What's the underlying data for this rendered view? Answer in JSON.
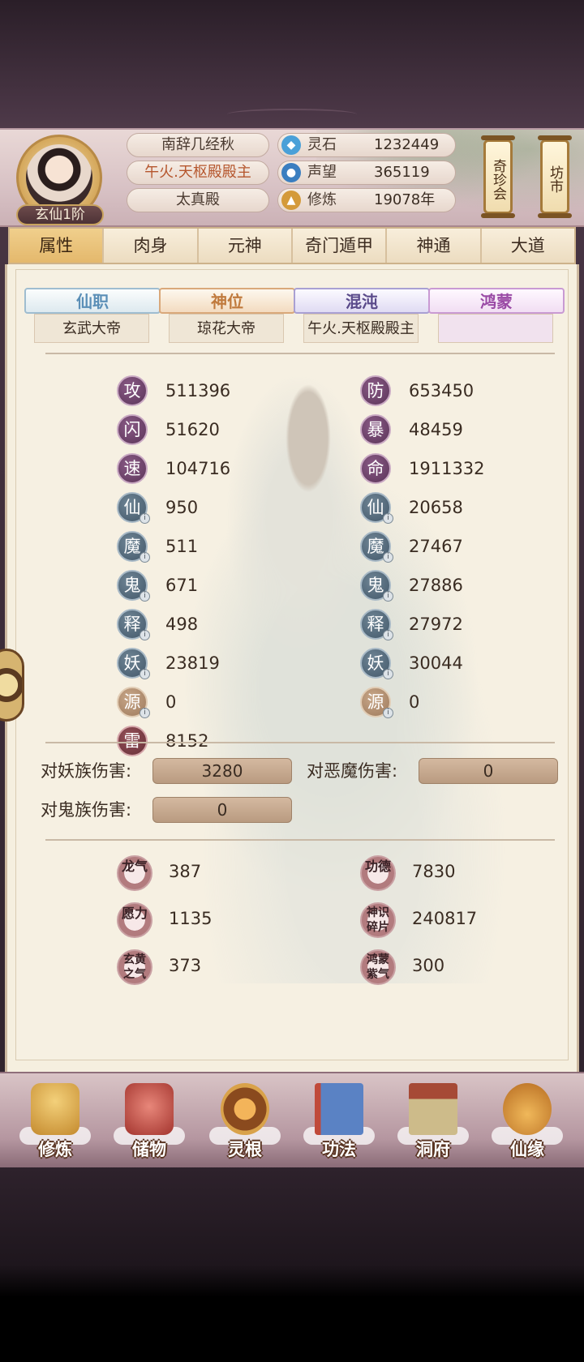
{
  "header": {
    "realm": "玄仙1阶",
    "titles": [
      "南辞几经秋",
      "午火.天枢殿殿主",
      "太真殿"
    ],
    "resources": [
      {
        "icon": "spirit-stone-icon",
        "label": "灵石",
        "value": "1232449"
      },
      {
        "icon": "prestige-icon",
        "label": "声望",
        "value": "365119"
      },
      {
        "icon": "cultivation-icon",
        "label": "修炼",
        "value": "19078年"
      }
    ],
    "side_buttons": [
      "奇珍会",
      "坊市"
    ]
  },
  "tabs": [
    {
      "label": "属性",
      "active": true
    },
    {
      "label": "肉身"
    },
    {
      "label": "元神"
    },
    {
      "label": "奇门遁甲"
    },
    {
      "label": "神通"
    },
    {
      "label": "大道"
    }
  ],
  "positions": [
    {
      "title": "仙职",
      "value": "玄武大帝"
    },
    {
      "title": "神位",
      "value": "琼花大帝"
    },
    {
      "title": "混沌",
      "value": "午火.天枢殿殿主"
    },
    {
      "title": "鸿蒙",
      "value": ""
    }
  ],
  "stats_left": [
    {
      "glyph": "攻",
      "value": "511396",
      "style": "purple"
    },
    {
      "glyph": "闪",
      "value": "51620",
      "style": "purple"
    },
    {
      "glyph": "速",
      "value": "104716",
      "style": "purple"
    },
    {
      "glyph": "仙",
      "value": "950",
      "style": "blue"
    },
    {
      "glyph": "魔",
      "value": "511",
      "style": "blue"
    },
    {
      "glyph": "鬼",
      "value": "671",
      "style": "blue"
    },
    {
      "glyph": "释",
      "value": "498",
      "style": "blue"
    },
    {
      "glyph": "妖",
      "value": "23819",
      "style": "blue"
    },
    {
      "glyph": "源",
      "value": "0",
      "style": "tan"
    },
    {
      "glyph": "雷",
      "value": "8152",
      "style": "red"
    }
  ],
  "stats_right": [
    {
      "glyph": "防",
      "value": "653450",
      "style": "purple"
    },
    {
      "glyph": "暴",
      "value": "48459",
      "style": "purple"
    },
    {
      "glyph": "命",
      "value": "1911332",
      "style": "purple"
    },
    {
      "glyph": "仙",
      "value": "20658",
      "style": "blue"
    },
    {
      "glyph": "魔",
      "value": "27467",
      "style": "blue"
    },
    {
      "glyph": "鬼",
      "value": "27886",
      "style": "blue"
    },
    {
      "glyph": "释",
      "value": "27972",
      "style": "blue"
    },
    {
      "glyph": "妖",
      "value": "30044",
      "style": "blue"
    },
    {
      "glyph": "源",
      "value": "0",
      "style": "tan"
    }
  ],
  "damage": [
    {
      "label": "对妖族伤害:",
      "value": "3280"
    },
    {
      "label": "对恶魔伤害:",
      "value": "0"
    },
    {
      "label": "对鬼族伤害:",
      "value": "0"
    }
  ],
  "misc": [
    {
      "glyph": "龙气",
      "value": "387"
    },
    {
      "glyph": "功德",
      "value": "7830"
    },
    {
      "glyph": "愿力",
      "value": "1135"
    },
    {
      "glyph": "神识碎片",
      "value": "240817"
    },
    {
      "glyph": "玄黄之气",
      "value": "373"
    },
    {
      "glyph": "鸿蒙紫气",
      "value": "300"
    }
  ],
  "bottom_nav": [
    {
      "label": "修炼",
      "icon": "monk-icon",
      "color": "#d9a64a"
    },
    {
      "label": "储物",
      "icon": "storage-bag-icon",
      "color": "#c0504a"
    },
    {
      "label": "灵根",
      "icon": "spirit-root-icon",
      "color": "#a8642a"
    },
    {
      "label": "功法",
      "icon": "book-icon",
      "color": "#4a6fb0"
    },
    {
      "label": "洞府",
      "icon": "cave-house-icon",
      "color": "#7a8a6a"
    },
    {
      "label": "仙缘",
      "icon": "gourd-icon",
      "color": "#d08a3a"
    }
  ]
}
